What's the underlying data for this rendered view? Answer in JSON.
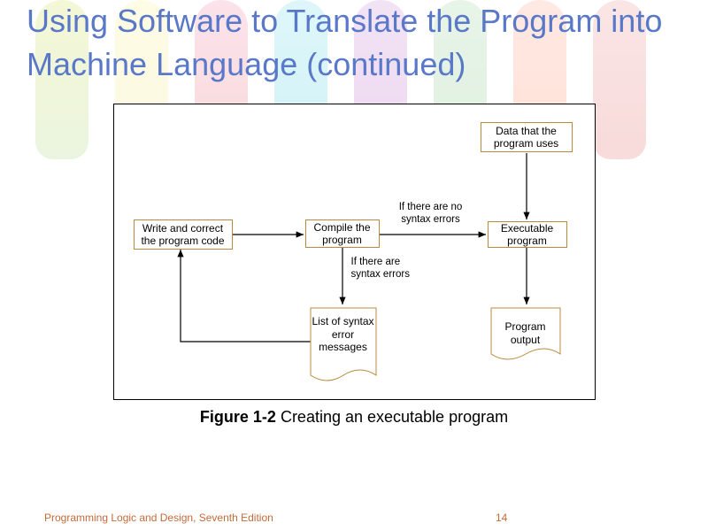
{
  "title": "Using Software to Translate the Program into Machine Language (continued)",
  "caption_label": "Figure 1-2",
  "caption_text": " Creating an executable program",
  "footer_text": "Programming Logic and Design, Seventh Edition",
  "page_number": "14",
  "diagram": {
    "nodes": {
      "write": "Write and correct the program code",
      "compile": "Compile the program",
      "data": "Data that the program uses",
      "exec": "Executable program",
      "errors": "List of syntax error messages",
      "output": "Program output"
    },
    "edges": {
      "no_errors": "If there are no syntax errors",
      "yes_errors": "If there are syntax errors"
    }
  }
}
